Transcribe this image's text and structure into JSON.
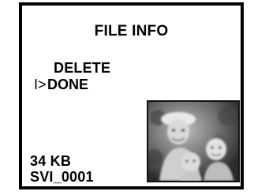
{
  "screen": {
    "title": "FILE INFO",
    "menu": {
      "items": [
        {
          "label": "DELETE"
        },
        {
          "label": "DONE",
          "selected": true
        }
      ],
      "cursor_glyph": "I>"
    },
    "file": {
      "size": "34 KB",
      "name": "SVI_0001"
    },
    "thumbnail": {
      "icon": "photo-thumbnail",
      "description_colors": {
        "background": "#2a2a2a",
        "foreground": "#e6e6e6"
      }
    }
  }
}
